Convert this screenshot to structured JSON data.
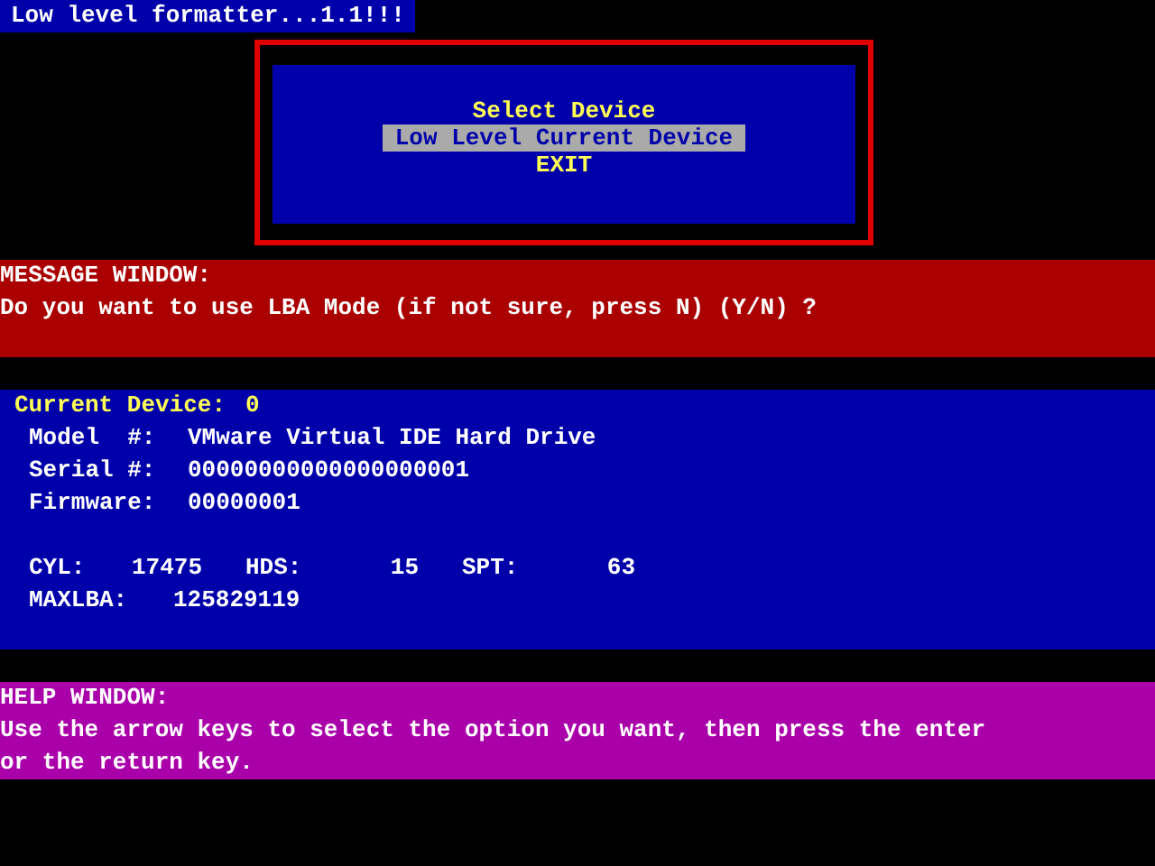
{
  "title_bar": {
    "text": "Low level formatter...1.1!!!"
  },
  "menu": {
    "items": [
      {
        "label": "Select Device",
        "selected": false
      },
      {
        "label": "Low Level Current Device",
        "selected": true
      },
      {
        "label": "EXIT",
        "selected": false
      }
    ]
  },
  "message_window": {
    "title": "MESSAGE WINDOW:",
    "text": "Do you want to use LBA Mode (if not sure, press N) (Y/N) ?"
  },
  "device_info": {
    "current_device": {
      "label": "Current Device:",
      "value": "0"
    },
    "fields": [
      {
        "label": "Model  #:",
        "value": "VMware Virtual IDE Hard Drive"
      },
      {
        "label": "Serial #:",
        "value": "00000000000000000001"
      },
      {
        "label": "Firmware:",
        "value": "00000001"
      }
    ],
    "geometry": [
      {
        "label": "CYL:",
        "value": "17475"
      },
      {
        "label": "HDS:",
        "value": "15"
      },
      {
        "label": "SPT:",
        "value": "63"
      }
    ],
    "maxlba": {
      "label": "MAXLBA:",
      "value": "125829119"
    }
  },
  "help_window": {
    "title": "HELP WINDOW:",
    "lines": [
      "Use the arrow keys to select the option you want, then press the enter",
      "or the return key."
    ]
  }
}
